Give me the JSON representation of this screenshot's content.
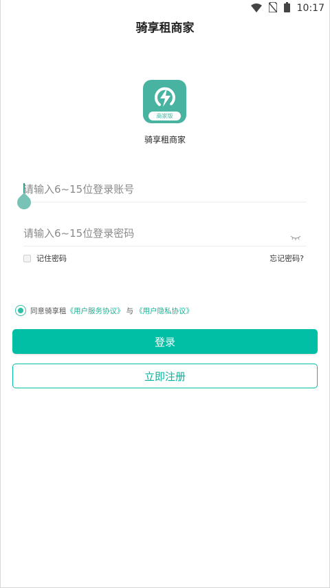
{
  "status_bar": {
    "time": "10:17",
    "icons": [
      "wifi-icon",
      "no-sim-icon",
      "battery-icon"
    ]
  },
  "header": {
    "title": "骑享租商家"
  },
  "logo": {
    "tag": "商家版",
    "app_name": "骑享租商家"
  },
  "form": {
    "account_placeholder": "请输入6~15位登录账号",
    "password_placeholder": "请输入6~15位登录密码",
    "remember_label": "记住密码",
    "forgot_label": "忘记密码?"
  },
  "agreement": {
    "prefix": "同意骑享租",
    "service_link": "《用户服务协议》",
    "and": "与",
    "privacy_link": "《用户隐私协议》"
  },
  "buttons": {
    "login": "登录",
    "register": "立即注册"
  },
  "colors": {
    "accent": "#00bfa5",
    "logo": "#49b3a2"
  }
}
